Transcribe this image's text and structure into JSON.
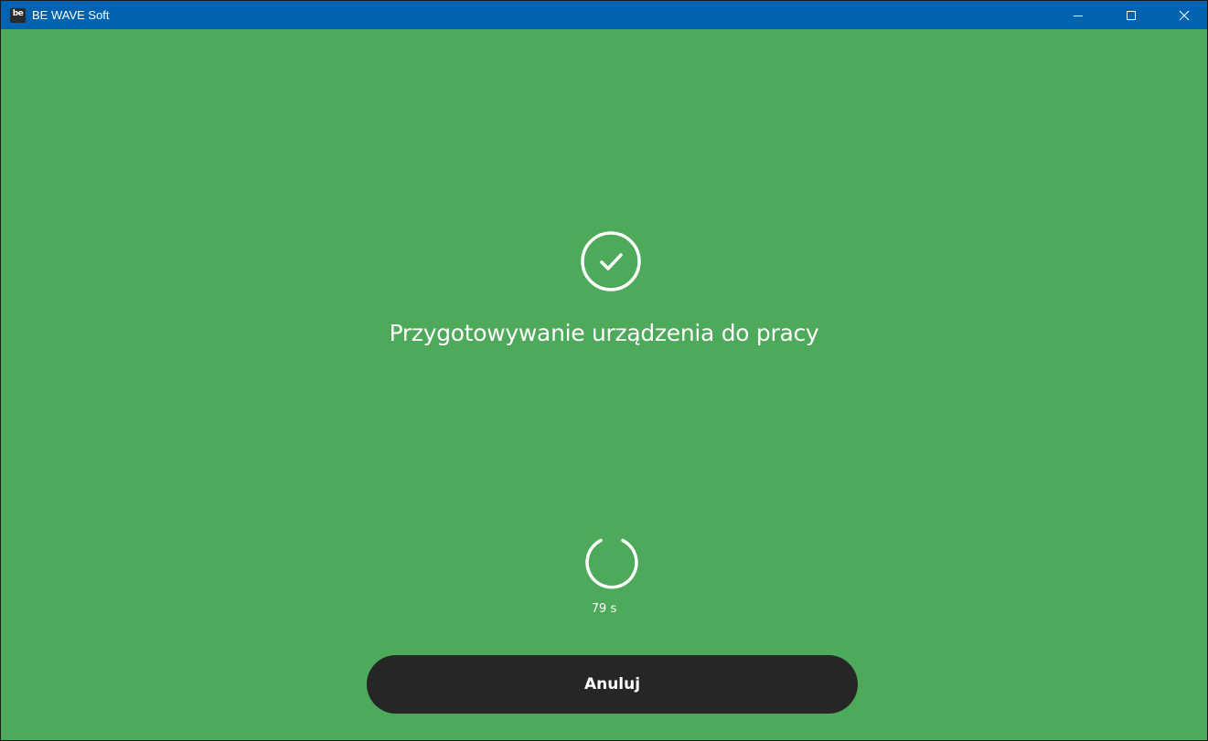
{
  "window": {
    "title": "BE WAVE Soft",
    "app_icon_label": "be",
    "controls": {
      "minimize": "minimize-icon",
      "maximize": "maximize-icon",
      "close": "close-icon"
    },
    "titlebar_color": "#0063b1"
  },
  "main": {
    "background_color": "#4caa5a",
    "status_icon": "check-circle-icon",
    "heading": "Przygotowywanie urządzenia do pracy",
    "spinner_icon": "loading-spinner-icon",
    "countdown": "79 s",
    "cancel_label": "Anuluj",
    "button_color": "#262626"
  }
}
